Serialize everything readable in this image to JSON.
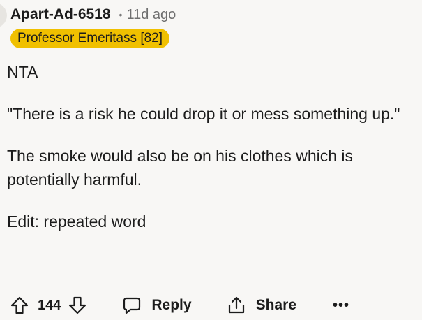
{
  "comment": {
    "username": "Apart-Ad-6518",
    "separator": "•",
    "time": "11d ago",
    "flair": "Professor Emeritass [82]",
    "paragraphs": [
      "NTA",
      "\"There is a risk he could drop it or mess something up.\"",
      "The smoke would also be on his clothes which is potentially harmful.",
      "Edit: repeated word"
    ]
  },
  "actions": {
    "upvote_icon": "upvote-arrow-icon",
    "score": "144",
    "downvote_icon": "downvote-arrow-icon",
    "reply_label": "Reply",
    "reply_icon": "speech-bubble-icon",
    "share_label": "Share",
    "share_icon": "share-upload-icon",
    "more_label": "•••"
  },
  "colors": {
    "background": "#f8f7f5",
    "flair": "#f0c000",
    "text": "#1c1c1c",
    "muted": "#6f6f6f"
  }
}
